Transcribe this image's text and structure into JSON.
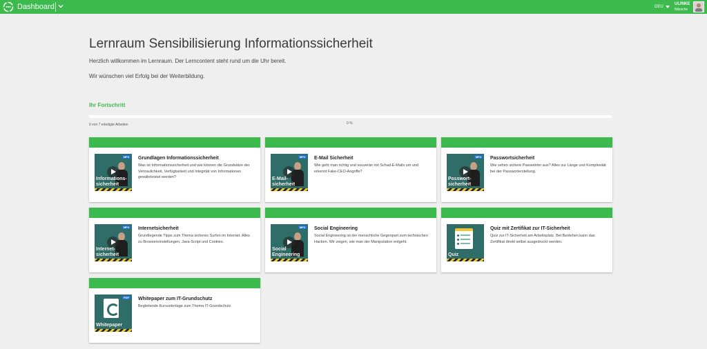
{
  "topbar": {
    "app_title": "Dashboard",
    "language": "DEU",
    "user_first": "ULRIKE",
    "user_last": "Nitzsche",
    "brand_color": "#3dba4e"
  },
  "header": {
    "title": "Lernraum Sensibilisierung Informationssicherheit",
    "intro_1": "Herzlich willkommen im Lernraum. Der Lerncontent steht rund um die Uhr bereit.",
    "intro_2": "Wir wünschen viel Erfolg bei der Weiterbildung."
  },
  "progress": {
    "heading": "Ihr Fortschritt",
    "count_text": "0 von 7 erledigte Arbeiten",
    "percent_text": "0 %",
    "percent_value": 0
  },
  "cards": [
    {
      "title": "Grundlagen Informationssicherheit",
      "description": "Was ist Informationssicherheit und wie können die Grundsätze der Vertraulichkeit, Verfügbarkeit und Integrität von Informationen gewährleistet werden?",
      "badge": "MP4",
      "thumb_label_1": "Informations-",
      "thumb_label_2": "sicherheit"
    },
    {
      "title": "E-Mail Sicherheit",
      "description": "Wie geht man richtig und souverän mit Schad-E-Mails um und erkennt Fake-CEO-Angriffe?",
      "badge": "MP4",
      "thumb_label_1": "E-Mail-",
      "thumb_label_2": "sicherheit"
    },
    {
      "title": "Passwortsicherheit",
      "description": "Wie sehen sichere Passwörter aus? Alles zur Länge und Komplexität bei der Passworterstellung.",
      "badge": "MP4",
      "thumb_label_1": "Passwort-",
      "thumb_label_2": "sicherheit"
    },
    {
      "title": "Internetsicherheit",
      "description": "Grundlegende Tipps zum Thema sicheres Surfen im Internet. Alles zu Browsereinstellungen, Java-Script und Cookies.",
      "badge": "MP4",
      "thumb_label_1": "Internet-",
      "thumb_label_2": "sicherheit"
    },
    {
      "title": "Social Engineering",
      "description": "Social Engineering ist der menschliche Gegenpart zum technischen Hacken. Wir zeigen, wie man der Manipulation entgeht.",
      "badge": "MP4",
      "thumb_label_1": "Social",
      "thumb_label_2": "Engineering"
    },
    {
      "title": "Quiz mit Zertifikat zur IT-Sicherheit",
      "description": "Quiz zur IT-Sicherheit am Arbeitsplatz. Bei Bestehen kann das Zertifikat direkt selbst ausgedruckt werden.",
      "badge": "",
      "thumb_label_1": "",
      "thumb_label_2": "Quiz"
    },
    {
      "title": "Whitepaper zum IT-Grundschutz",
      "description": "Begleitende Kursunterlage zum Thema IT-Grundschutz",
      "badge": "PDF",
      "thumb_label_1": "",
      "thumb_label_2": "Whitepaper"
    }
  ]
}
